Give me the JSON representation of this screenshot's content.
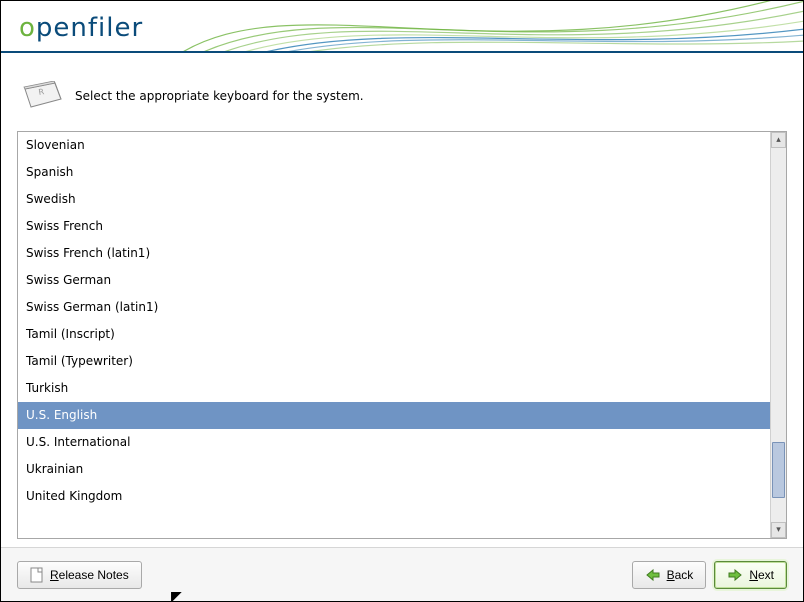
{
  "app": {
    "name": "openfiler"
  },
  "prompt": "Select the appropriate keyboard for the system.",
  "keyboard_list": {
    "items": [
      "Slovenian",
      "Spanish",
      "Swedish",
      "Swiss French",
      "Swiss French (latin1)",
      "Swiss German",
      "Swiss German (latin1)",
      "Tamil (Inscript)",
      "Tamil (Typewriter)",
      "Turkish",
      "U.S. English",
      "U.S. International",
      "Ukrainian",
      "United Kingdom"
    ],
    "selected": "U.S. English"
  },
  "buttons": {
    "release_notes": "Release Notes",
    "back": "Back",
    "next": "Next"
  }
}
